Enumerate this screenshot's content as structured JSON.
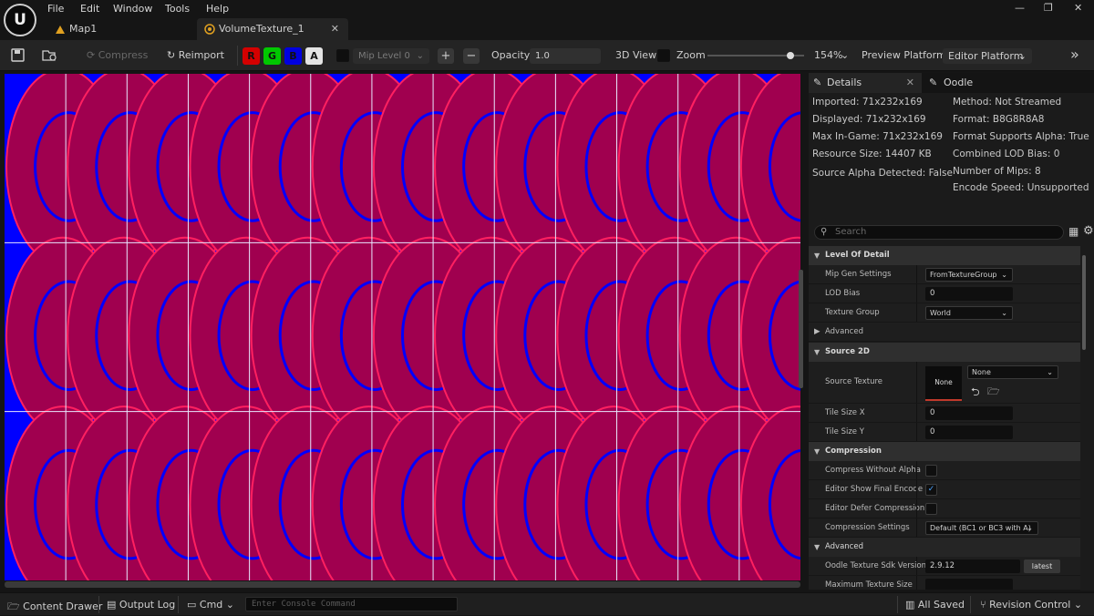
{
  "menu": {
    "file": "File",
    "edit": "Edit",
    "window": "Window",
    "tools": "Tools",
    "help": "Help"
  },
  "tabs": [
    {
      "label": "Map1"
    },
    {
      "label": "VolumeTexture_1"
    }
  ],
  "toolbar": {
    "compress": "Compress",
    "reimport": "Reimport",
    "channels": {
      "r": "R",
      "g": "G",
      "b": "B",
      "a": "A"
    },
    "mip_level": "Mip Level 0",
    "plus": "+",
    "minus": "−",
    "opacity_label": "Opacity",
    "opacity_value": "1.0",
    "view3d": "3D View",
    "zoom_label": "Zoom",
    "zoom_value": "154%",
    "zoom_level": 0.82,
    "preview_platform_label": "Preview Platform:",
    "preview_platform_value": "Editor Platform"
  },
  "viewport": {
    "columns": 13,
    "rows": 3,
    "tint_primary": "#0000ff",
    "tint_secondary": "#a0004f"
  },
  "details": {
    "tab_details": "Details",
    "tab_oodle": "Oodle",
    "info_left": [
      "Imported: 71x232x169",
      "Displayed: 71x232x169",
      "Max In-Game: 71x232x169",
      "Resource Size: 14407 KB",
      "Source Alpha Detected: False"
    ],
    "info_right": [
      "Method: Not Streamed",
      "Format: B8G8R8A8",
      "Format Supports Alpha: True",
      "Combined LOD Bias: 0",
      "Number of Mips: 8",
      "Encode Speed: Unsupported"
    ],
    "search_placeholder": "Search",
    "cat_lod": "Level Of Detail",
    "mip_gen_label": "Mip Gen Settings",
    "mip_gen_value": "FromTextureGroup",
    "lod_bias_label": "LOD Bias",
    "lod_bias_value": "0",
    "texture_group_label": "Texture Group",
    "texture_group_value": "World",
    "advanced1": "Advanced",
    "cat_source2d": "Source 2D",
    "source_texture_label": "Source Texture",
    "source_texture_thumb": "None",
    "source_texture_value": "None",
    "tile_x_label": "Tile Size X",
    "tile_x_value": "0",
    "tile_y_label": "Tile Size Y",
    "tile_y_value": "0",
    "cat_compression": "Compression",
    "cwa_label": "Compress Without Alpha",
    "cwa_checked": false,
    "esfe_label": "Editor Show Final Encode",
    "esfe_checked": true,
    "edc_label": "Editor Defer Compression",
    "edc_checked": false,
    "cs_label": "Compression Settings",
    "cs_value": "Default (BC1 or BC3 with A)",
    "advanced2": "Advanced",
    "oodle_ver_label": "Oodle Texture Sdk Version",
    "oodle_ver_value": "2.9.12",
    "oodle_ver_btn": "latest",
    "max_tex_label": "Maximum Texture Size"
  },
  "status": {
    "content_drawer": "Content Drawer",
    "output_log": "Output Log",
    "cmd": "Cmd",
    "console_placeholder": "Enter Console Command",
    "all_saved": "All Saved",
    "revision_control": "Revision Control"
  }
}
